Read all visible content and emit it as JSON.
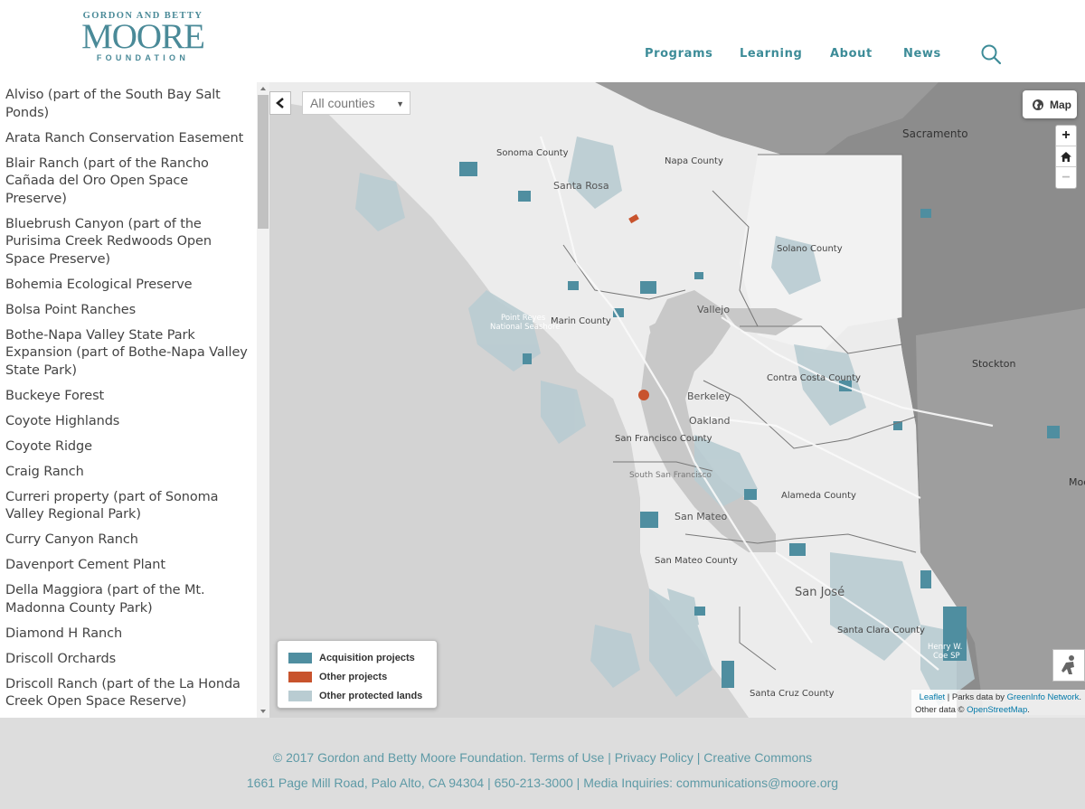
{
  "logo": {
    "line1": "GORDON AND BETTY",
    "line2": "MOORE",
    "line3": "FOUNDATION"
  },
  "nav": {
    "items": [
      "Programs",
      "Learning",
      "About",
      "News"
    ]
  },
  "sidebar": {
    "items": [
      "Alviso (part of the South Bay Salt Ponds)",
      "Arata Ranch Conservation Easement",
      "Blair Ranch (part of the Rancho Cañada del Oro Open Space Preserve)",
      "Bluebrush Canyon (part of the Purisima Creek Redwoods Open Space Preserve)",
      "Bohemia Ecological Preserve",
      "Bolsa Point Ranches",
      "Bothe-Napa Valley State Park Expansion (part of Bothe-Napa Valley State Park)",
      "Buckeye Forest",
      "Coyote Highlands",
      "Coyote Ridge",
      "Craig Ranch",
      "Curreri property (part of Sonoma Valley Regional Park)",
      "Curry Canyon Ranch",
      "Davenport Cement Plant",
      "Della Maggiora (part of the Mt. Madonna County Park)",
      "Diamond H Ranch",
      "Driscoll Orchards",
      "Driscoll Ranch (part of the La Honda Creek Open Space Reserve)"
    ]
  },
  "map": {
    "county_select": "All counties",
    "layer_button": "Map",
    "zoom_in": "+",
    "zoom_out": "−",
    "legend": [
      {
        "label": "Acquisition projects",
        "color": "#4f8ea0"
      },
      {
        "label": "Other projects",
        "color": "#c8532d"
      },
      {
        "label": "Other protected lands",
        "color": "#b9ccd2"
      }
    ],
    "attribution": {
      "leaflet": "Leaflet",
      "parks_prefix": " | Parks data by ",
      "greeninfo": "GreenInfo Network",
      "other_prefix": "Other data © ",
      "osm": "OpenStreetMap"
    },
    "labels": {
      "sacramento": "Sacramento",
      "sonoma": "Sonoma County",
      "napa": "Napa County",
      "santa_rosa": "Santa Rosa",
      "solano": "Solano County",
      "vallejo": "Vallejo",
      "point_reyes": "Point Reyes",
      "national_seashore": "National Seashore",
      "marin": "Marin County",
      "stockton": "Stockton",
      "contra_costa": "Contra Costa County",
      "berkeley": "Berkeley",
      "oakland": "Oakland",
      "sf_county": "San Francisco County",
      "south_sf": "South San Francisco",
      "alameda": "Alameda County",
      "modesto": "Mode",
      "san_mateo": "San Mateo",
      "san_mateo_county": "San Mateo County",
      "san_jose": "San José",
      "santa_clara": "Santa Clara County",
      "henry_w": "Henry W.",
      "coe_sp": "Coe SP",
      "santa_cruz": "Santa Cruz County"
    }
  },
  "footer": {
    "line1": "© 2017 Gordon and Betty Moore Foundation. Terms of Use | Privacy Policy | Creative Commons",
    "line2": "1661 Page Mill Road, Palo Alto, CA 94304 | 650-213-3000 | Media Inquiries: communications@moore.org"
  }
}
